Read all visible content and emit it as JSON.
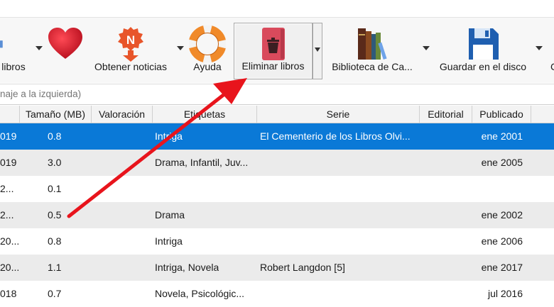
{
  "toolbar": {
    "buttons": [
      {
        "label": "libros",
        "icon": "add-books-icon"
      },
      {
        "label": "",
        "icon": "heart-icon"
      },
      {
        "label": "Obtener noticias",
        "icon": "news-icon"
      },
      {
        "label": "Ayuda",
        "icon": "lifebuoy-icon"
      },
      {
        "label": "Eliminar libros",
        "icon": "delete-books-icon"
      },
      {
        "label": "Biblioteca de Ca...",
        "icon": "library-icon"
      },
      {
        "label": "Guardar en el disco",
        "icon": "save-disk-icon"
      },
      {
        "label": "C",
        "icon": "connect-icon"
      }
    ]
  },
  "search": {
    "placeholder": "naje a la izquierda)"
  },
  "table": {
    "columns": [
      "",
      "Tamaño (MB)",
      "Valoración",
      "Etiquetas",
      "Serie",
      "Editorial",
      "Publicado"
    ],
    "rows": [
      {
        "date": "019",
        "size": "0.8",
        "rating": "",
        "tags": "Intriga",
        "series": "El Cementerio de los Libros Olvi...",
        "publisher": "",
        "published": "ene 2001"
      },
      {
        "date": "019",
        "size": "3.0",
        "rating": "",
        "tags": "Drama, Infantil, Juv...",
        "series": "",
        "publisher": "",
        "published": "ene 2005"
      },
      {
        "date": "2...",
        "size": "0.1",
        "rating": "",
        "tags": "",
        "series": "",
        "publisher": "",
        "published": ""
      },
      {
        "date": "2...",
        "size": "0.5",
        "rating": "",
        "tags": "Drama",
        "series": "",
        "publisher": "",
        "published": "ene 2002"
      },
      {
        "date": "20...",
        "size": "0.8",
        "rating": "",
        "tags": "Intriga",
        "series": "",
        "publisher": "",
        "published": "ene 2006"
      },
      {
        "date": "20...",
        "size": "1.1",
        "rating": "",
        "tags": "Intriga, Novela",
        "series": "Robert Langdon [5]",
        "publisher": "",
        "published": "ene 2017"
      },
      {
        "date": "018",
        "size": "0.7",
        "rating": "",
        "tags": "Novela, Psicológic...",
        "series": "",
        "publisher": "",
        "published": "jul 2016"
      }
    ]
  },
  "colors": {
    "selection": "#0a79d7",
    "annotation_arrow": "#e8141c"
  }
}
